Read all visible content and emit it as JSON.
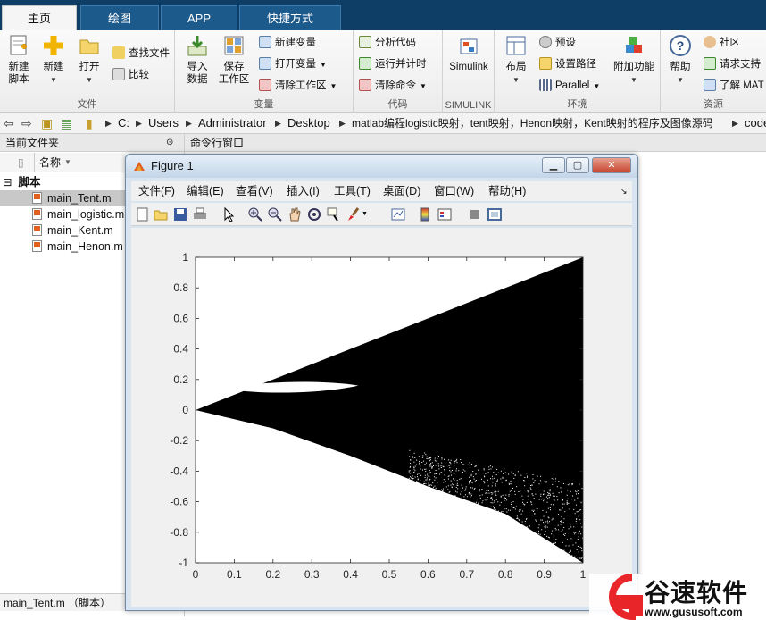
{
  "tabs": [
    {
      "label": "主页",
      "active": true
    },
    {
      "label": "绘图",
      "active": false
    },
    {
      "label": "APP",
      "active": false
    },
    {
      "label": "快捷方式",
      "active": false
    }
  ],
  "ribbon": {
    "file_group": {
      "label": "文件",
      "new_script": "新建\n脚本",
      "new": "新建",
      "open": "打开",
      "find_files": "查找文件",
      "compare": "比较"
    },
    "variable_group": {
      "label": "变量",
      "import": "导入\n数据",
      "save_ws": "保存\n工作区",
      "new_var": "新建变量",
      "open_var": "打开变量",
      "clear_ws": "清除工作区"
    },
    "code_group": {
      "label": "代码",
      "analyze": "分析代码",
      "run_time": "运行并计时",
      "clear_cmd": "清除命令"
    },
    "simulink_group": {
      "label": "SIMULINK",
      "simulink": "Simulink"
    },
    "env_group": {
      "label": "环境",
      "layout": "布局",
      "prefs": "预设",
      "set_path": "设置路径",
      "parallel": "Parallel",
      "addons": "附加功能"
    },
    "resources_group": {
      "label": "资源",
      "help": "帮助",
      "community": "社区",
      "request_support": "请求支持",
      "learn": "了解 MAT"
    }
  },
  "address": {
    "crumbs": [
      "C:",
      "Users",
      "Administrator",
      "Desktop",
      "matlab编程logistic映射，tent映射，Henon映射，Kent映射的程序及图像源码",
      "code"
    ]
  },
  "panels": {
    "current_folder": "当前文件夹",
    "command_window": "命令行窗口",
    "name_col": "名称"
  },
  "files": {
    "group": "脚本",
    "items": [
      "main_Tent.m",
      "main_logistic.m",
      "main_Kent.m",
      "main_Henon.m"
    ],
    "selected": "main_Tent.m"
  },
  "status": {
    "text": "main_Tent.m （脚本）"
  },
  "figure": {
    "title": "Figure 1",
    "menu": [
      "文件(F)",
      "编辑(E)",
      "查看(V)",
      "插入(I)",
      "工具(T)",
      "桌面(D)",
      "窗口(W)",
      "帮助(H)"
    ]
  },
  "chart_data": {
    "type": "scatter",
    "title": "",
    "xlabel": "",
    "ylabel": "",
    "xlim": [
      0,
      1
    ],
    "ylim": [
      -1,
      1
    ],
    "xticks": [
      "0",
      "0.1",
      "0.2",
      "0.3",
      "0.4",
      "0.5",
      "0.6",
      "0.7",
      "0.8",
      "0.9",
      "1"
    ],
    "yticks": [
      "-1",
      "-0.8",
      "-0.6",
      "-0.4",
      "-0.2",
      "0",
      "0.2",
      "0.4",
      "0.6",
      "0.8",
      "1"
    ],
    "upper_envelope": [
      [
        0,
        0
      ],
      [
        0.5,
        0.5
      ],
      [
        1,
        1
      ]
    ],
    "lower_envelope": [
      [
        0,
        0
      ],
      [
        0.2,
        -0.12
      ],
      [
        0.4,
        -0.3
      ],
      [
        0.6,
        -0.5
      ],
      [
        0.8,
        -0.68
      ],
      [
        1,
        -1
      ]
    ],
    "gap_region": {
      "x_range": [
        0.07,
        0.42
      ],
      "center_y": 0.14
    },
    "point_color": "#000000"
  },
  "watermark": {
    "text": "谷速软件",
    "url": "www.gususoft.com"
  },
  "colors": {
    "tabbar": "#0e3d66",
    "accent_red": "#e8262a"
  }
}
